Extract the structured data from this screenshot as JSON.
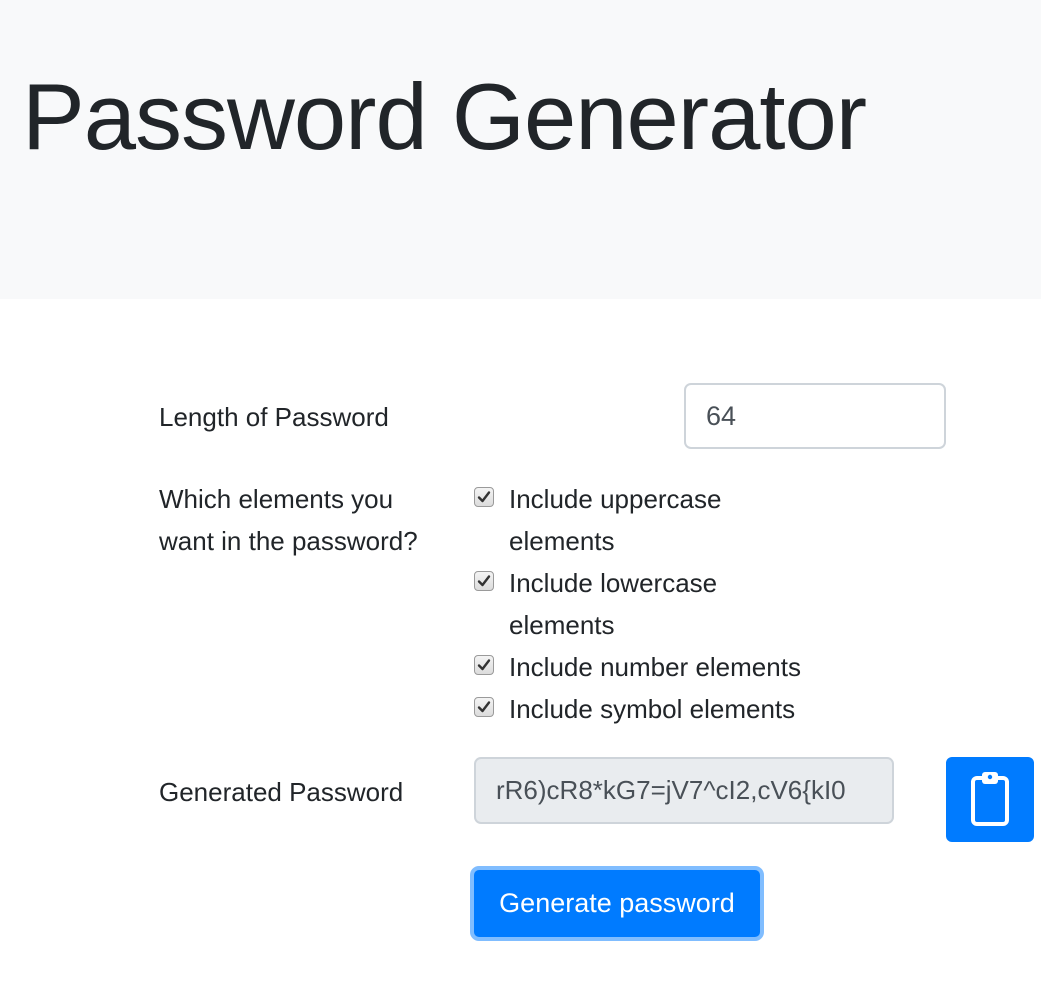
{
  "header": {
    "title": "Password Generator"
  },
  "form": {
    "length_label": "Length of Password",
    "length_value": "64",
    "elements_label": "Which elements you want in the password?",
    "options": [
      {
        "label": "Include uppercase elements",
        "checked": true
      },
      {
        "label": "Include lowercase elements",
        "checked": true
      },
      {
        "label": "Include number elements",
        "checked": true
      },
      {
        "label": "Include symbol elements",
        "checked": true
      }
    ],
    "generated_label": "Generated Password",
    "generated_value": "rR6)cR8*kG7=jV7^cI2,cV6{kI0",
    "clipboard_icon": "clipboard-icon",
    "generate_button_label": "Generate password"
  },
  "colors": {
    "primary": "#007bff",
    "jumbotron_bg": "#f8f9fa",
    "readonly_bg": "#e9ecef"
  }
}
